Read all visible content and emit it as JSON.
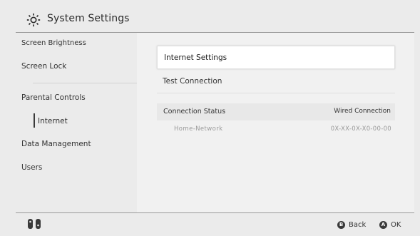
{
  "header": {
    "title": "System Settings",
    "icon": "gear-icon"
  },
  "sidebar": {
    "items": [
      {
        "label": "Screen Brightness"
      },
      {
        "label": "Screen Lock"
      },
      {
        "label": "Parental Controls"
      },
      {
        "label": "Internet",
        "selected": true
      },
      {
        "label": "Data Management"
      },
      {
        "label": "Users"
      }
    ]
  },
  "content": {
    "options": [
      {
        "label": "Internet Settings",
        "selected": true
      },
      {
        "label": "Test Connection"
      }
    ],
    "status": {
      "label": "Connection Status",
      "value": "Wired Connection",
      "network_name": "Home-Network",
      "network_id": "0X-XX-0X-X0-00-00"
    }
  },
  "footer": {
    "back_button": "B",
    "back_label": "Back",
    "ok_button": "A",
    "ok_label": "OK",
    "controller_icon": "joycon-icon"
  },
  "colors": {
    "background": "#ebebeb",
    "panel": "#f1f1f1",
    "selected": "#ffffff",
    "text": "#2d2d2d"
  }
}
